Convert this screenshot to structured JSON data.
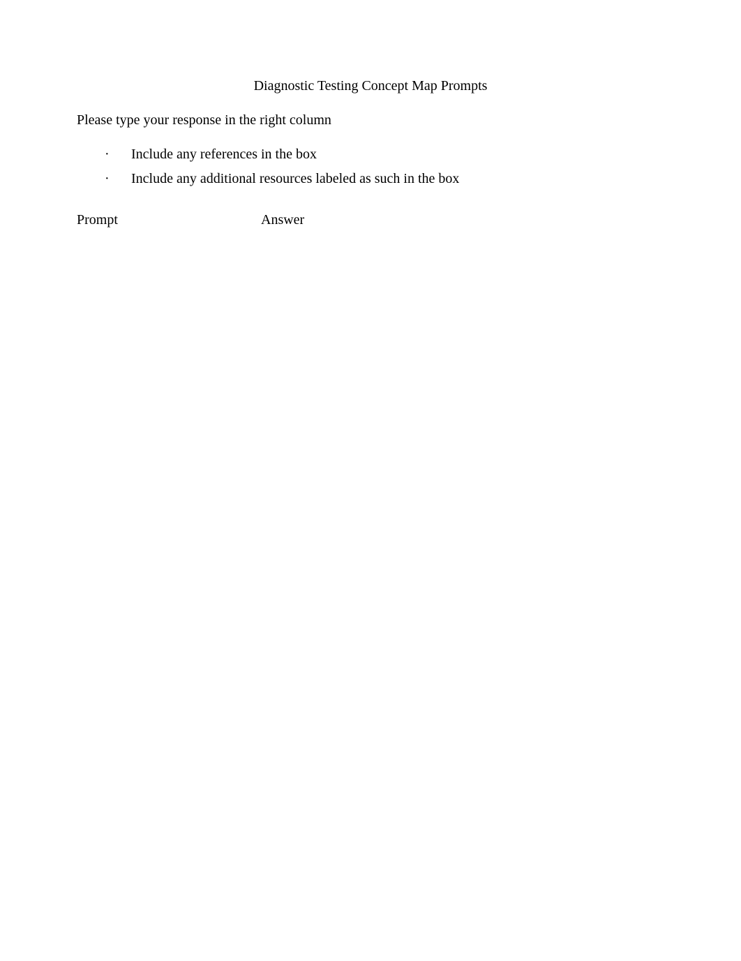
{
  "title": "Diagnostic Testing Concept Map Prompts",
  "instruction": "Please type your response in the right column",
  "bullets": [
    {
      "text": "Include any references in the box"
    },
    {
      "text": "Include any additional resources labeled as such in the box"
    }
  ],
  "table": {
    "headers": {
      "prompt": "Prompt",
      "answer": "Answer"
    }
  }
}
